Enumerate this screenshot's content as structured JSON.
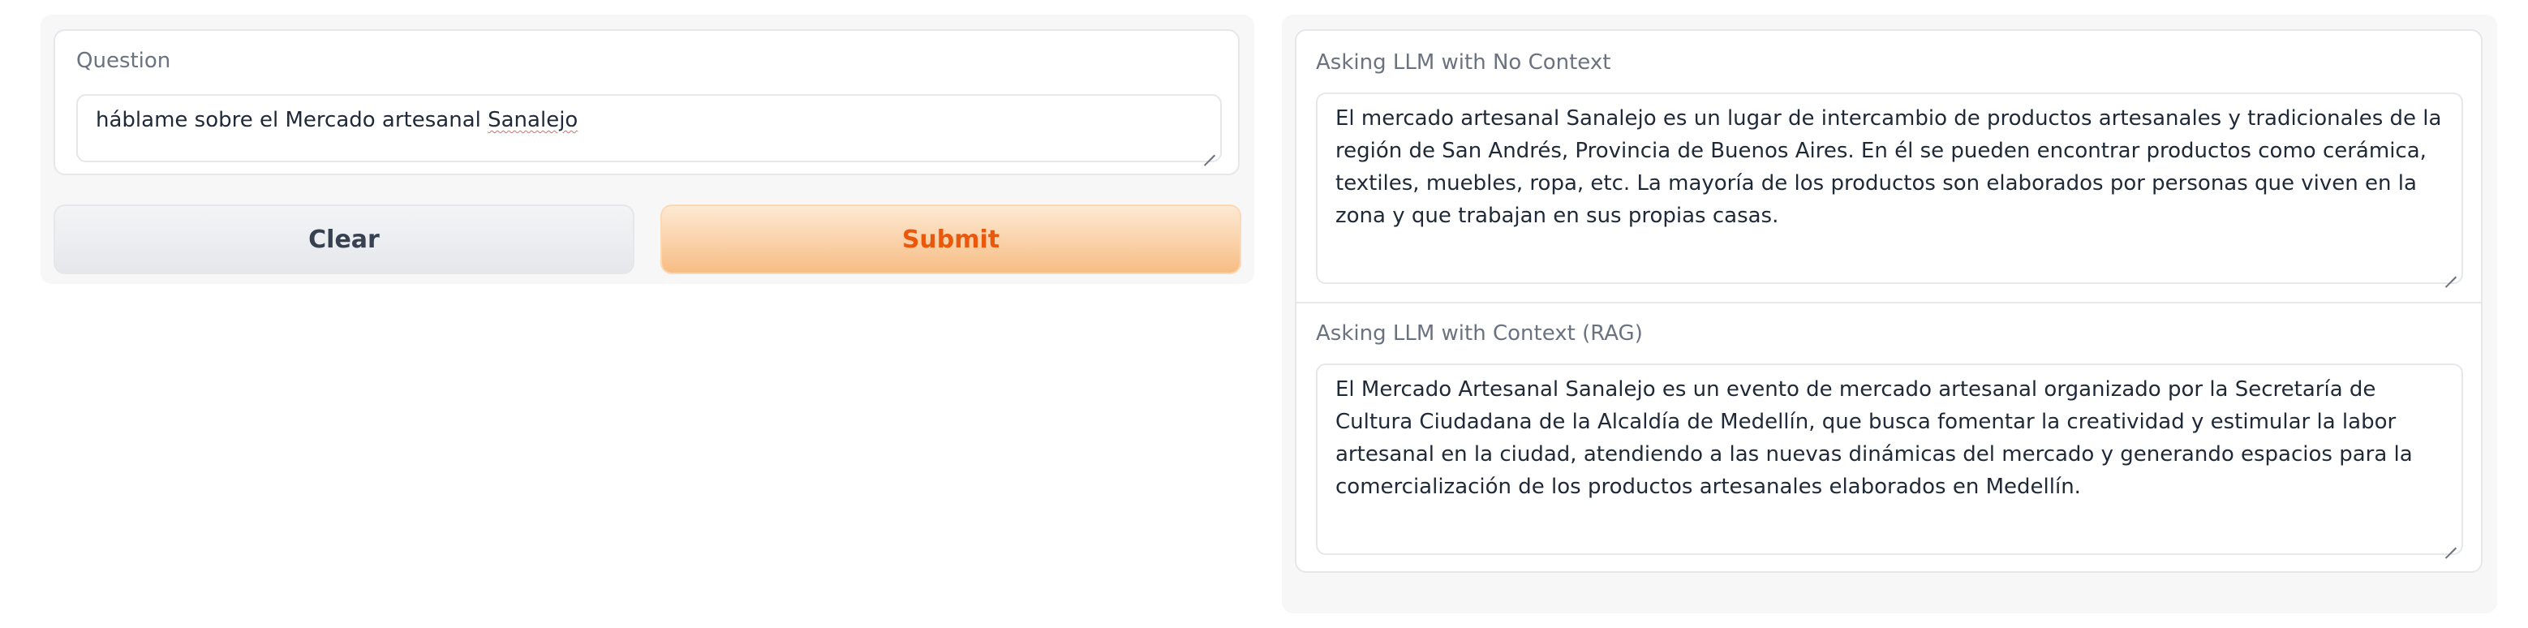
{
  "question": {
    "label": "Question",
    "value_prefix": "háblame sobre el Mercado artesanal ",
    "value_misspelled": "Sanalejo"
  },
  "buttons": {
    "clear_label": "Clear",
    "submit_label": "Submit"
  },
  "output_no_context": {
    "label": "Asking LLM with No Context",
    "text": " El mercado artesanal Sanalejo es un lugar de intercambio de productos artesanales y tradicionales de la región de San Andrés, Provincia de Buenos Aires. En él se pueden encontrar productos como cerámica, textiles, muebles, ropa, etc. La mayoría de los productos son elaborados por personas que viven en la zona y que trabajan en sus propias casas."
  },
  "output_rag": {
    "label": "Asking LLM with Context (RAG)",
    "text": " El Mercado Artesanal Sanalejo es un evento de mercado artesanal organizado por la Secretaría de Cultura Ciudadana de la Alcaldía de Medellín, que busca fomentar la creatividad y estimular la labor artesanal en la ciudad, atendiendo a las nuevas dinámicas del mercado y generando espacios para la comercialización de los productos artesanales elaborados en Medellín."
  },
  "colors": {
    "submit_text": "#ea580c",
    "submit_gradient_end": "#f7bd84",
    "panel_bg": "#f7f7f8",
    "border": "#e5e7eb"
  }
}
